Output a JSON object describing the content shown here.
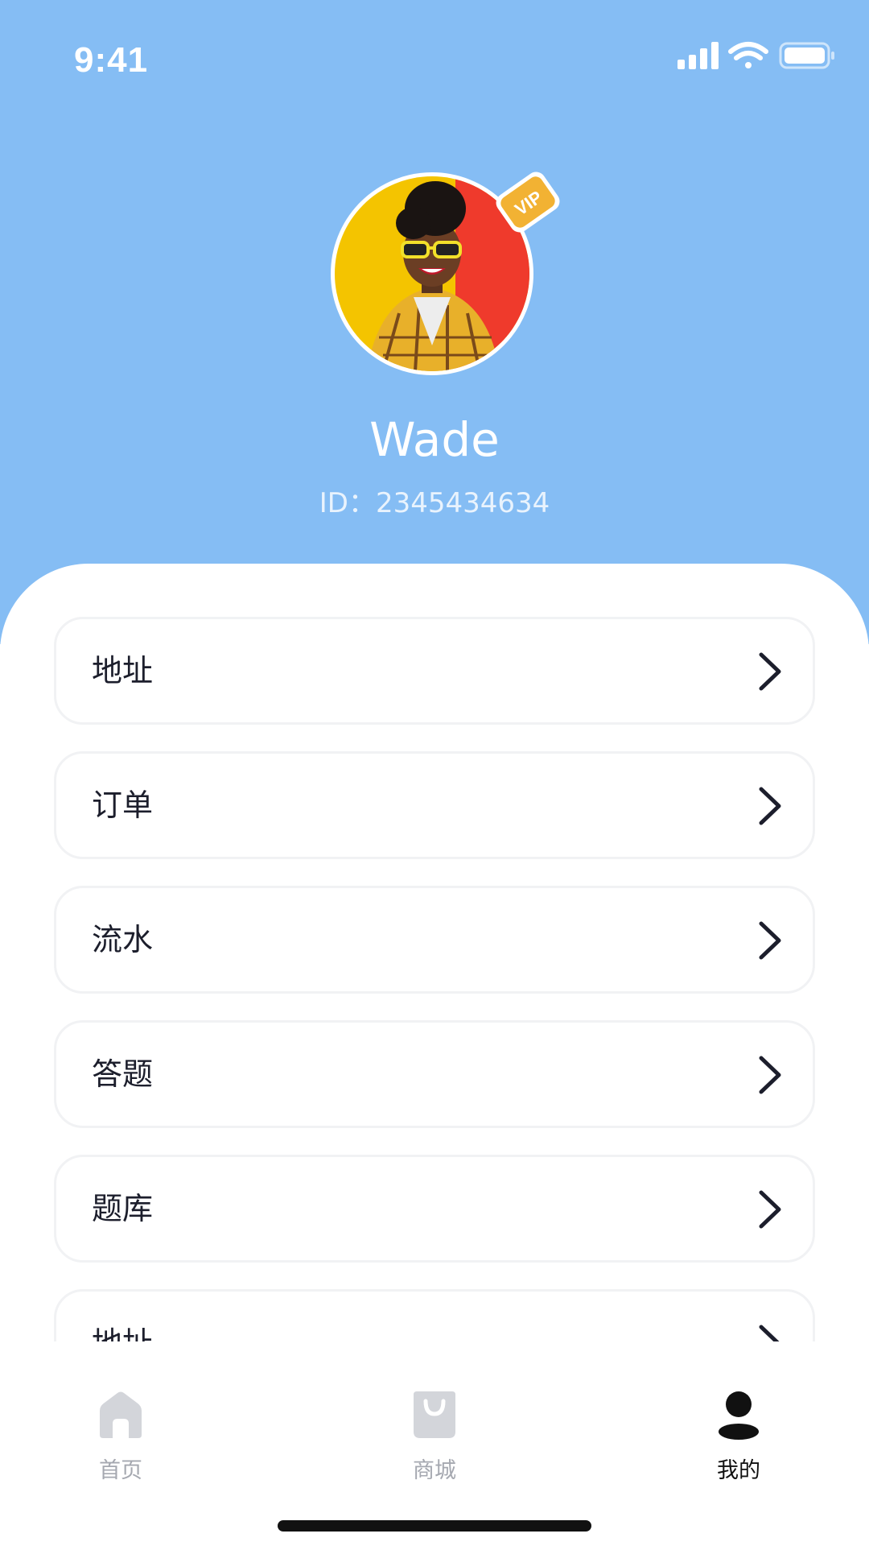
{
  "status_bar": {
    "time": "9:41",
    "icons": [
      "signal-icon",
      "wifi-icon",
      "battery-icon"
    ]
  },
  "profile": {
    "name": "Wade",
    "id_text": "ID：2345434634",
    "badge_text": "VIP"
  },
  "menu": {
    "items": [
      {
        "label": "地址"
      },
      {
        "label": "订单"
      },
      {
        "label": "流水"
      },
      {
        "label": "答题"
      },
      {
        "label": "题库"
      },
      {
        "label": "地址"
      }
    ]
  },
  "tab_bar": {
    "tabs": [
      {
        "label": "首页",
        "icon": "home-icon",
        "active": false
      },
      {
        "label": "商城",
        "icon": "shopping-bag-icon",
        "active": false
      },
      {
        "label": "我的",
        "icon": "user-icon",
        "active": true
      }
    ]
  },
  "colors": {
    "header_bg": "#85BDF4",
    "text_dark": "#1C1E2C",
    "tab_inactive": "#A5A8B0",
    "tab_active": "#111111",
    "vip_gold": "#F2B233"
  }
}
